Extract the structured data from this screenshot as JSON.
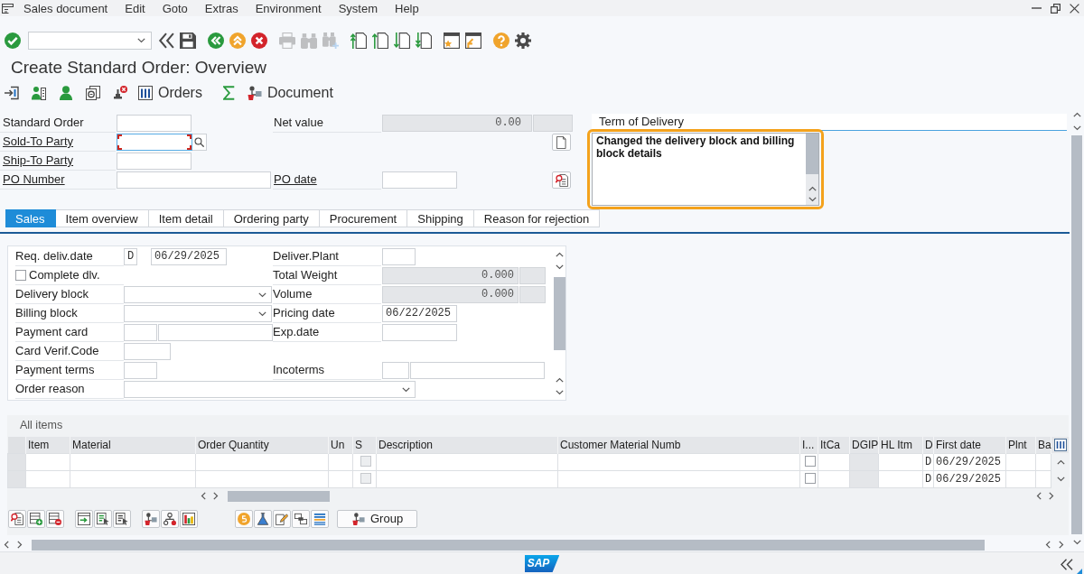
{
  "menu_bar": {
    "items": [
      "Sales document",
      "Edit",
      "Goto",
      "Extras",
      "Environment",
      "System",
      "Help"
    ]
  },
  "toolbar": {
    "groups": [
      {
        "buttons": [
          {
            "kind": "enter",
            "disabled": false
          }
        ]
      },
      {
        "buttons": [
          {
            "kind": "collapse",
            "disabled": false
          },
          {
            "kind": "save",
            "disabled": false
          }
        ]
      },
      {
        "buttons": [
          {
            "kind": "back",
            "disabled": false
          },
          {
            "kind": "exit",
            "disabled": false
          },
          {
            "kind": "cancel",
            "disabled": false
          }
        ]
      },
      {
        "buttons": [
          {
            "kind": "print",
            "disabled": true
          },
          {
            "kind": "find",
            "disabled": true
          },
          {
            "kind": "find-next",
            "disabled": true
          }
        ]
      },
      {
        "buttons": [
          {
            "kind": "first-page",
            "disabled": false
          },
          {
            "kind": "previous-page",
            "disabled": false
          },
          {
            "kind": "next-page",
            "disabled": false
          },
          {
            "kind": "last-page",
            "disabled": false
          }
        ]
      },
      {
        "buttons": [
          {
            "kind": "new-session",
            "disabled": false
          },
          {
            "kind": "shortcut",
            "disabled": false
          }
        ]
      },
      {
        "buttons": [
          {
            "kind": "help",
            "disabled": false
          },
          {
            "kind": "settings",
            "disabled": false
          }
        ]
      }
    ]
  },
  "title": "Create Standard Order: Overview",
  "app_toolbar": {
    "items": [
      {
        "kind": "import"
      },
      {
        "kind": "person-doc"
      },
      {
        "kind": "person"
      },
      {
        "kind": "documents"
      },
      {
        "kind": "stamp-error"
      },
      {
        "kind": "orders",
        "label": "Orders"
      },
      {
        "kind": "sum"
      },
      {
        "kind": "document",
        "label": "Document"
      }
    ]
  },
  "header": {
    "rows": [
      {
        "label": "Standard Order",
        "underlined": false,
        "field": {
          "kind": "input",
          "focused": false
        },
        "right": {
          "label": "Net value",
          "underlined": false,
          "kind": "amount",
          "value": "0.00"
        }
      },
      {
        "label": "Sold-To Party",
        "underlined": true,
        "field": {
          "kind": "search",
          "focused": true
        },
        "side_button": {
          "kind": "new-document"
        }
      },
      {
        "label": "Ship-To Party",
        "underlined": true,
        "field": {
          "kind": "input",
          "focused": false
        }
      },
      {
        "label": "PO Number",
        "underlined": true,
        "field": {
          "kind": "wide",
          "focused": false
        },
        "right": {
          "label": "PO date",
          "underlined": true,
          "kind": "date"
        },
        "side_button": {
          "kind": "document-search"
        }
      }
    ]
  },
  "term_of_delivery": {
    "title": "Term of Delivery",
    "text": "Changed the delivery block and billing block details",
    "highlighted": true
  },
  "tabs": [
    {
      "label": "Sales",
      "selected": true
    },
    {
      "label": "Item overview",
      "selected": false
    },
    {
      "label": "Item detail",
      "selected": false
    },
    {
      "label": "Ordering party",
      "selected": false
    },
    {
      "label": "Procurement",
      "selected": false
    },
    {
      "label": "Shipping",
      "selected": false
    },
    {
      "label": "Reason for rejection",
      "selected": false
    }
  ],
  "sales_tab": {
    "rows": [
      {
        "left": {
          "label": "Req. deliv.date",
          "kind": "date-with-format",
          "format": "D",
          "value": "06/29/2025"
        },
        "right": {
          "label": "Deliver.Plant",
          "kind": "code"
        }
      },
      {
        "left": {
          "label": "Complete dlv.",
          "kind": "checkbox",
          "checked": false
        },
        "right": {
          "label": "Total Weight",
          "kind": "measure",
          "value": "0.000"
        }
      },
      {
        "left": {
          "label": "Delivery block",
          "kind": "dropdown"
        },
        "right": {
          "label": "Volume",
          "kind": "measure",
          "value": "0.000"
        }
      },
      {
        "left": {
          "label": "Billing block",
          "kind": "dropdown"
        },
        "right": {
          "label": "Pricing date",
          "kind": "date",
          "value": "06/22/2025"
        }
      },
      {
        "left": {
          "label": "Payment card",
          "kind": "card"
        },
        "right": {
          "label": "Exp.date",
          "kind": "date"
        }
      },
      {
        "left": {
          "label": "Card Verif.Code",
          "kind": "cvc"
        }
      },
      {
        "left": {
          "label": "Payment terms",
          "kind": "code"
        },
        "right": {
          "label": "Incoterms",
          "kind": "incoterms"
        }
      },
      {
        "left": {
          "label": "Order reason",
          "kind": "long-dropdown"
        }
      }
    ]
  },
  "items": {
    "title": "All items",
    "columns": [
      {
        "label": "Item",
        "kind": "text"
      },
      {
        "label": "Material",
        "kind": "text"
      },
      {
        "label": "Order Quantity",
        "kind": "text"
      },
      {
        "label": "Un",
        "kind": "text"
      },
      {
        "label": "S",
        "kind": "status"
      },
      {
        "label": "Description",
        "kind": "text"
      },
      {
        "label": "Customer Material Numb",
        "kind": "text"
      },
      {
        "label": "I...",
        "kind": "indicator"
      },
      {
        "label": "ItCa",
        "kind": "text"
      },
      {
        "label": "DGIP",
        "kind": "shaded"
      },
      {
        "label": "HL Itm",
        "kind": "text"
      },
      {
        "label": "D",
        "kind": "format"
      },
      {
        "label": "First date",
        "kind": "first-date"
      },
      {
        "label": "Plnt",
        "kind": "text"
      },
      {
        "label": "Ba",
        "kind": "text"
      }
    ],
    "rows": [
      {
        "selected": false,
        "status_checked": false,
        "indicator_checked": false,
        "format": "D",
        "first_date": "06/29/2025"
      },
      {
        "selected": false,
        "status_checked": false,
        "indicator_checked": false,
        "format": "D",
        "first_date": "06/29/2025"
      }
    ]
  },
  "item_toolbar": {
    "groups": [
      {
        "buttons": [
          {
            "kind": "details"
          },
          {
            "kind": "insert-row"
          },
          {
            "kind": "delete-row"
          }
        ]
      },
      {
        "buttons": [
          {
            "kind": "move"
          },
          {
            "kind": "select-all"
          },
          {
            "kind": "deselect"
          }
        ]
      },
      {
        "buttons": [
          {
            "kind": "configure"
          },
          {
            "kind": "tree"
          },
          {
            "kind": "chart"
          }
        ]
      },
      {
        "buttons": [
          {
            "kind": "pricing"
          },
          {
            "kind": "product"
          },
          {
            "kind": "edit-text"
          },
          {
            "kind": "components"
          },
          {
            "kind": "stack"
          }
        ]
      }
    ],
    "group_button": {
      "kind": "configure",
      "label": "Group"
    }
  },
  "status_bar": {
    "logo": "SAP"
  }
}
